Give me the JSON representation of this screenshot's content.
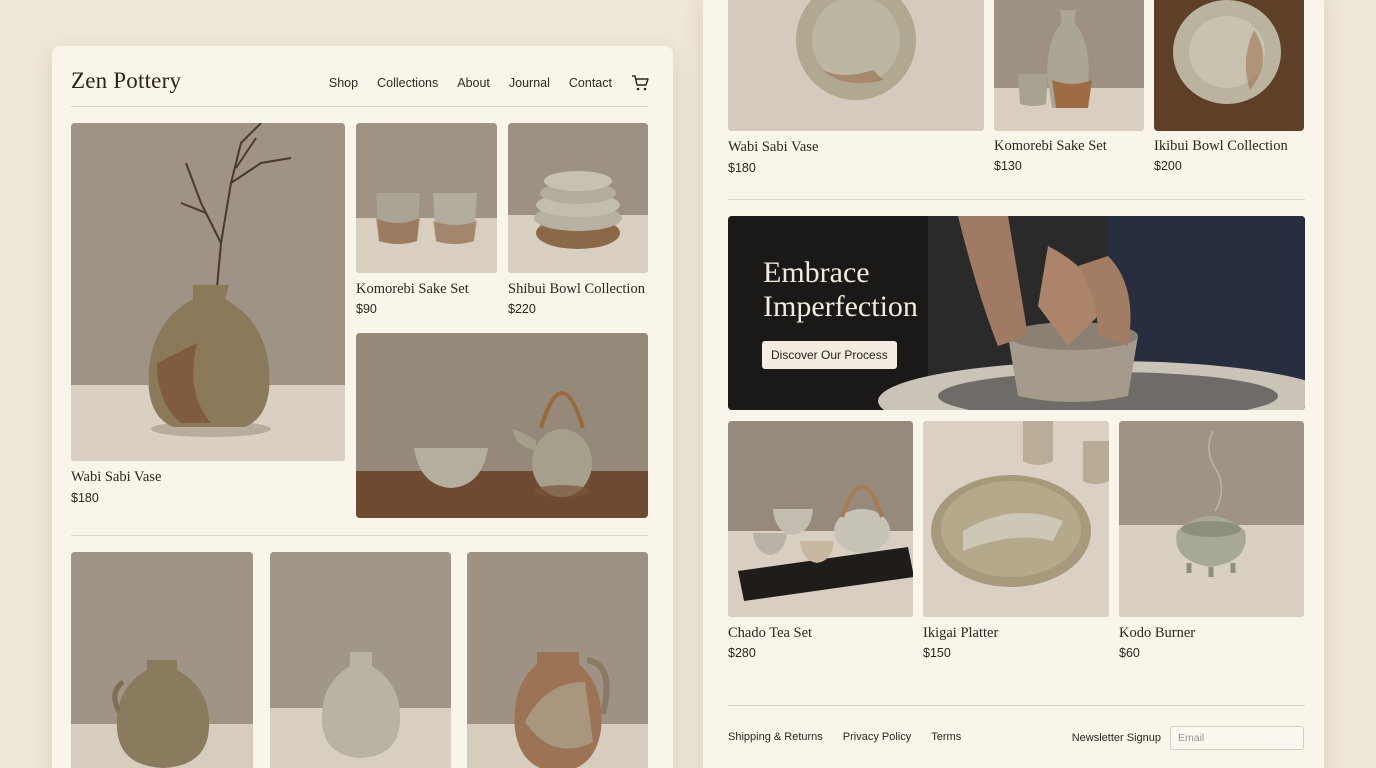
{
  "colors": {
    "background": "#efe7d7",
    "panel": "#faf5ea",
    "text": "#2b2620",
    "accent_clay": "#9c6a45"
  },
  "header": {
    "brand": "Zen Pottery",
    "nav": [
      "Shop",
      "Collections",
      "About",
      "Journal",
      "Contact"
    ],
    "cart_icon": "cart-icon"
  },
  "left": {
    "featured": {
      "name": "Wabi Sabi Vase",
      "price": "$180"
    },
    "cards": [
      {
        "name": "Komorebi Sake Set",
        "price": "$90"
      },
      {
        "name": "Shibui Bowl Collection",
        "price": "$220"
      }
    ]
  },
  "right": {
    "top_cards": [
      {
        "name": "Wabi Sabi Vase",
        "price": "$180"
      },
      {
        "name": "Komorebi Sake Set",
        "price": "$130"
      },
      {
        "name": "Ikibui Bowl Collection",
        "price": "$200"
      }
    ],
    "banner": {
      "title_line1": "Embrace",
      "title_line2": "Imperfection",
      "button": "Discover Our Process"
    },
    "products": [
      {
        "name": "Chado Tea Set",
        "price": "$280"
      },
      {
        "name": "Ikigai Platter",
        "price": "$150"
      },
      {
        "name": "Kodo Burner",
        "price": "$60"
      }
    ]
  },
  "footer": {
    "links": [
      "Shipping & Returns",
      "Privacy Policy",
      "Terms"
    ],
    "newsletter_label": "Newsletter Signup",
    "email_placeholder": "Email"
  }
}
